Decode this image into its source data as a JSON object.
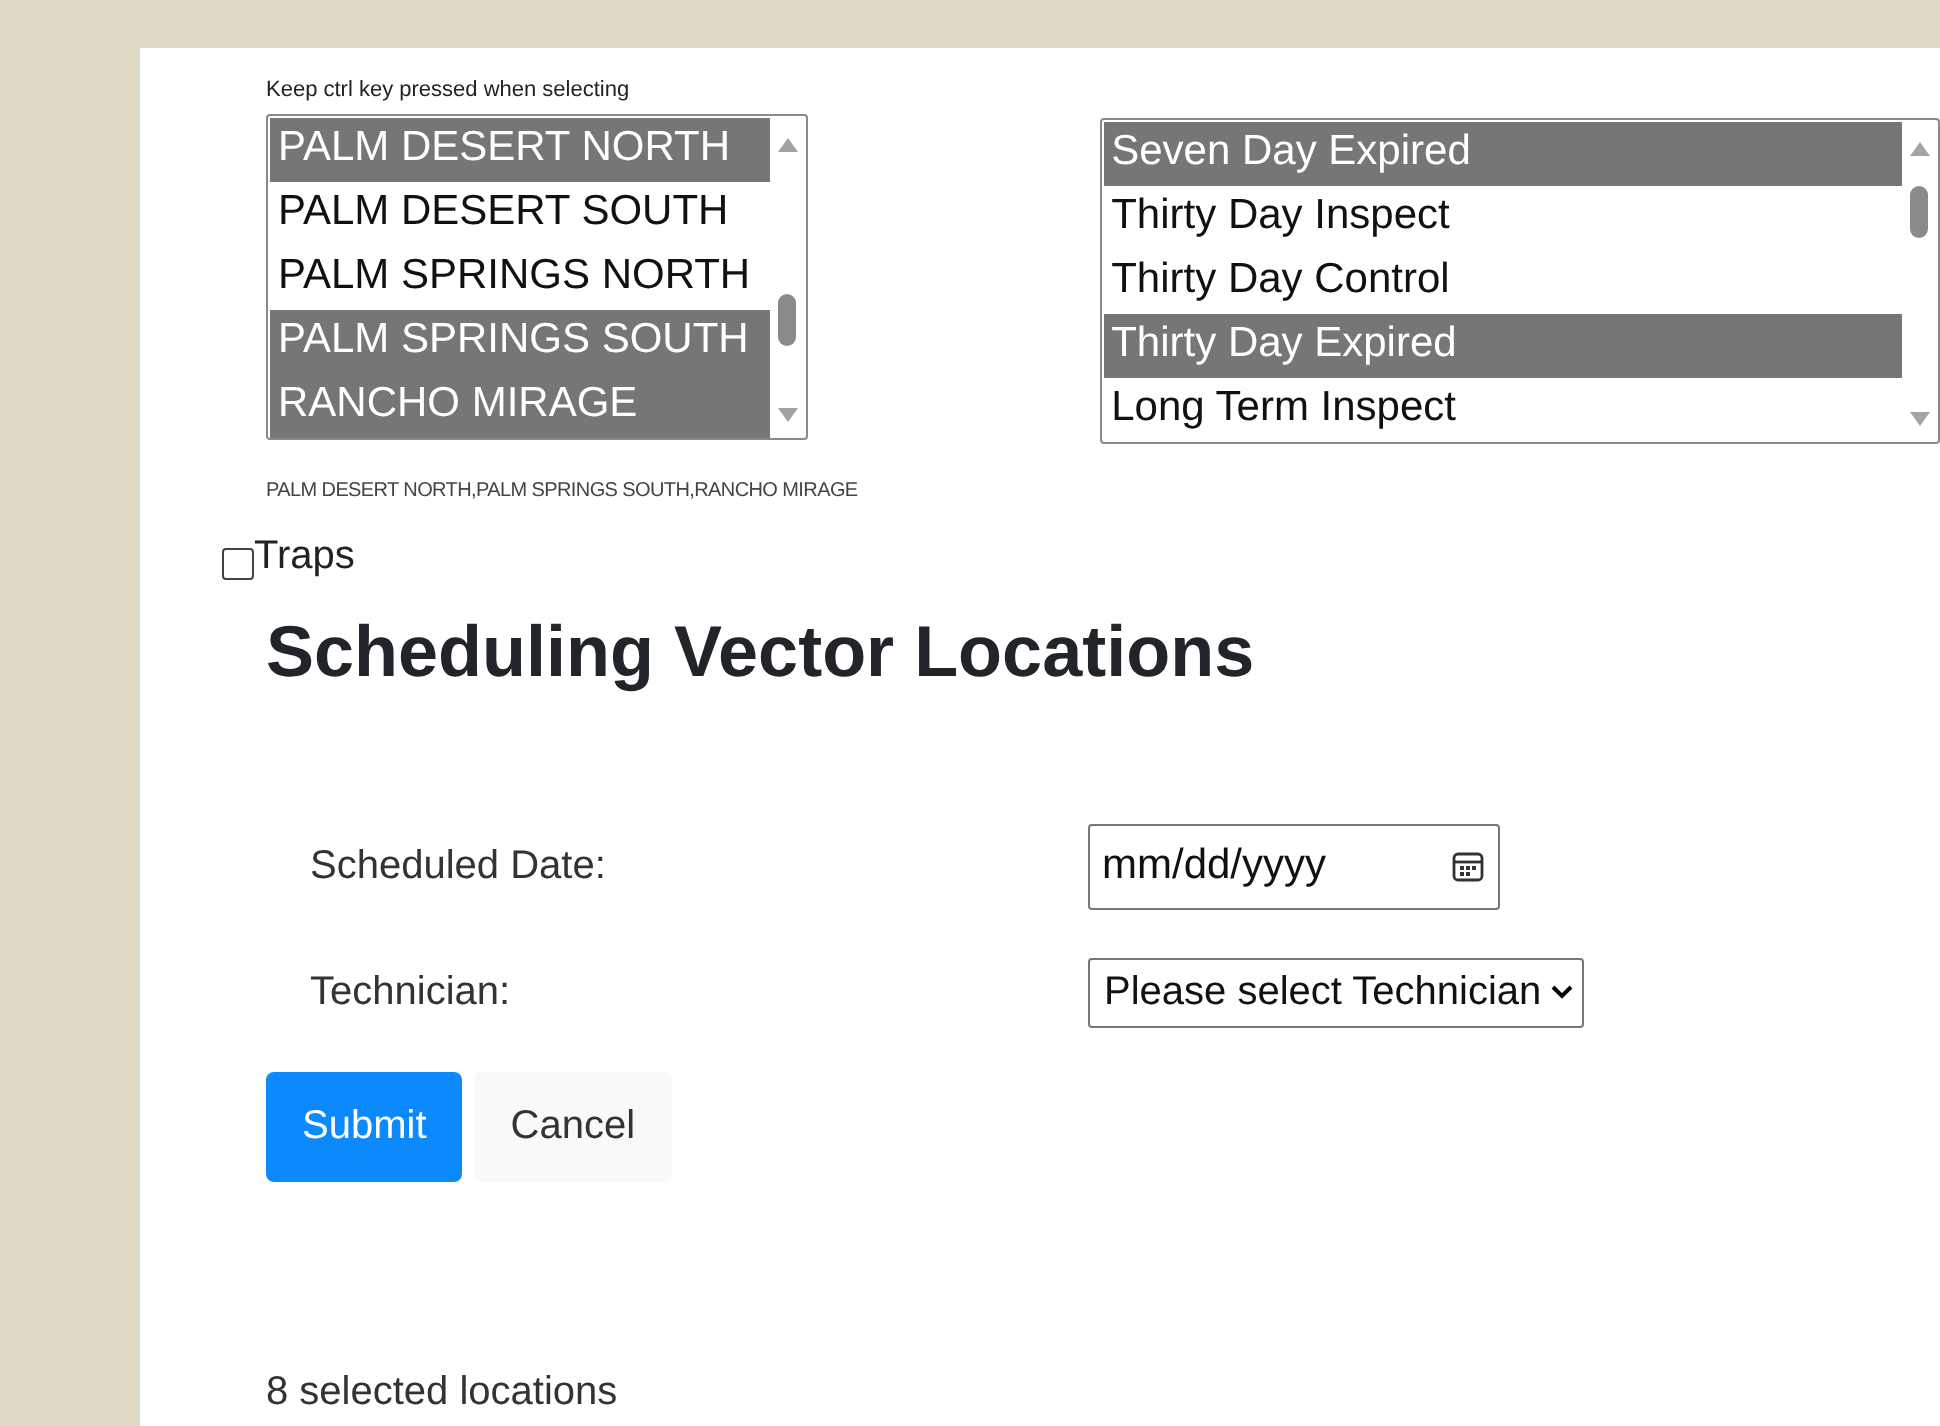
{
  "hint": "Keep ctrl key pressed when selecting",
  "lists": [
    {
      "items": [
        {
          "label": "PALM DESERT NORTH",
          "selected": true
        },
        {
          "label": "PALM DESERT SOUTH",
          "selected": false
        },
        {
          "label": "PALM SPRINGS NORTH",
          "selected": false
        },
        {
          "label": "PALM SPRINGS SOUTH",
          "selected": true
        },
        {
          "label": "RANCHO MIRAGE",
          "selected": true
        }
      ]
    },
    {
      "items": [
        {
          "label": "Seven Day Expired",
          "selected": true
        },
        {
          "label": "Thirty Day Inspect",
          "selected": false
        },
        {
          "label": "Thirty Day Control",
          "selected": false
        },
        {
          "label": "Thirty Day Expired",
          "selected": true
        },
        {
          "label": "Long Term Inspect",
          "selected": false
        }
      ]
    }
  ],
  "selection_summary": "PALM DESERT NORTH,PALM SPRINGS SOUTH,RANCHO MIRAGE",
  "traps": {
    "label": "Traps",
    "checked": false
  },
  "heading": "Scheduling Vector Locations",
  "fields": [
    {
      "label": "Scheduled Date:",
      "kind": "date",
      "placeholder": "mm/dd/yyyy"
    },
    {
      "label": "Technician:",
      "kind": "select",
      "value": "Please select Technician"
    }
  ],
  "buttons": [
    {
      "label": "Submit",
      "kind": "primary"
    },
    {
      "label": "Cancel",
      "kind": "secondary"
    }
  ],
  "footer": "8 selected locations"
}
